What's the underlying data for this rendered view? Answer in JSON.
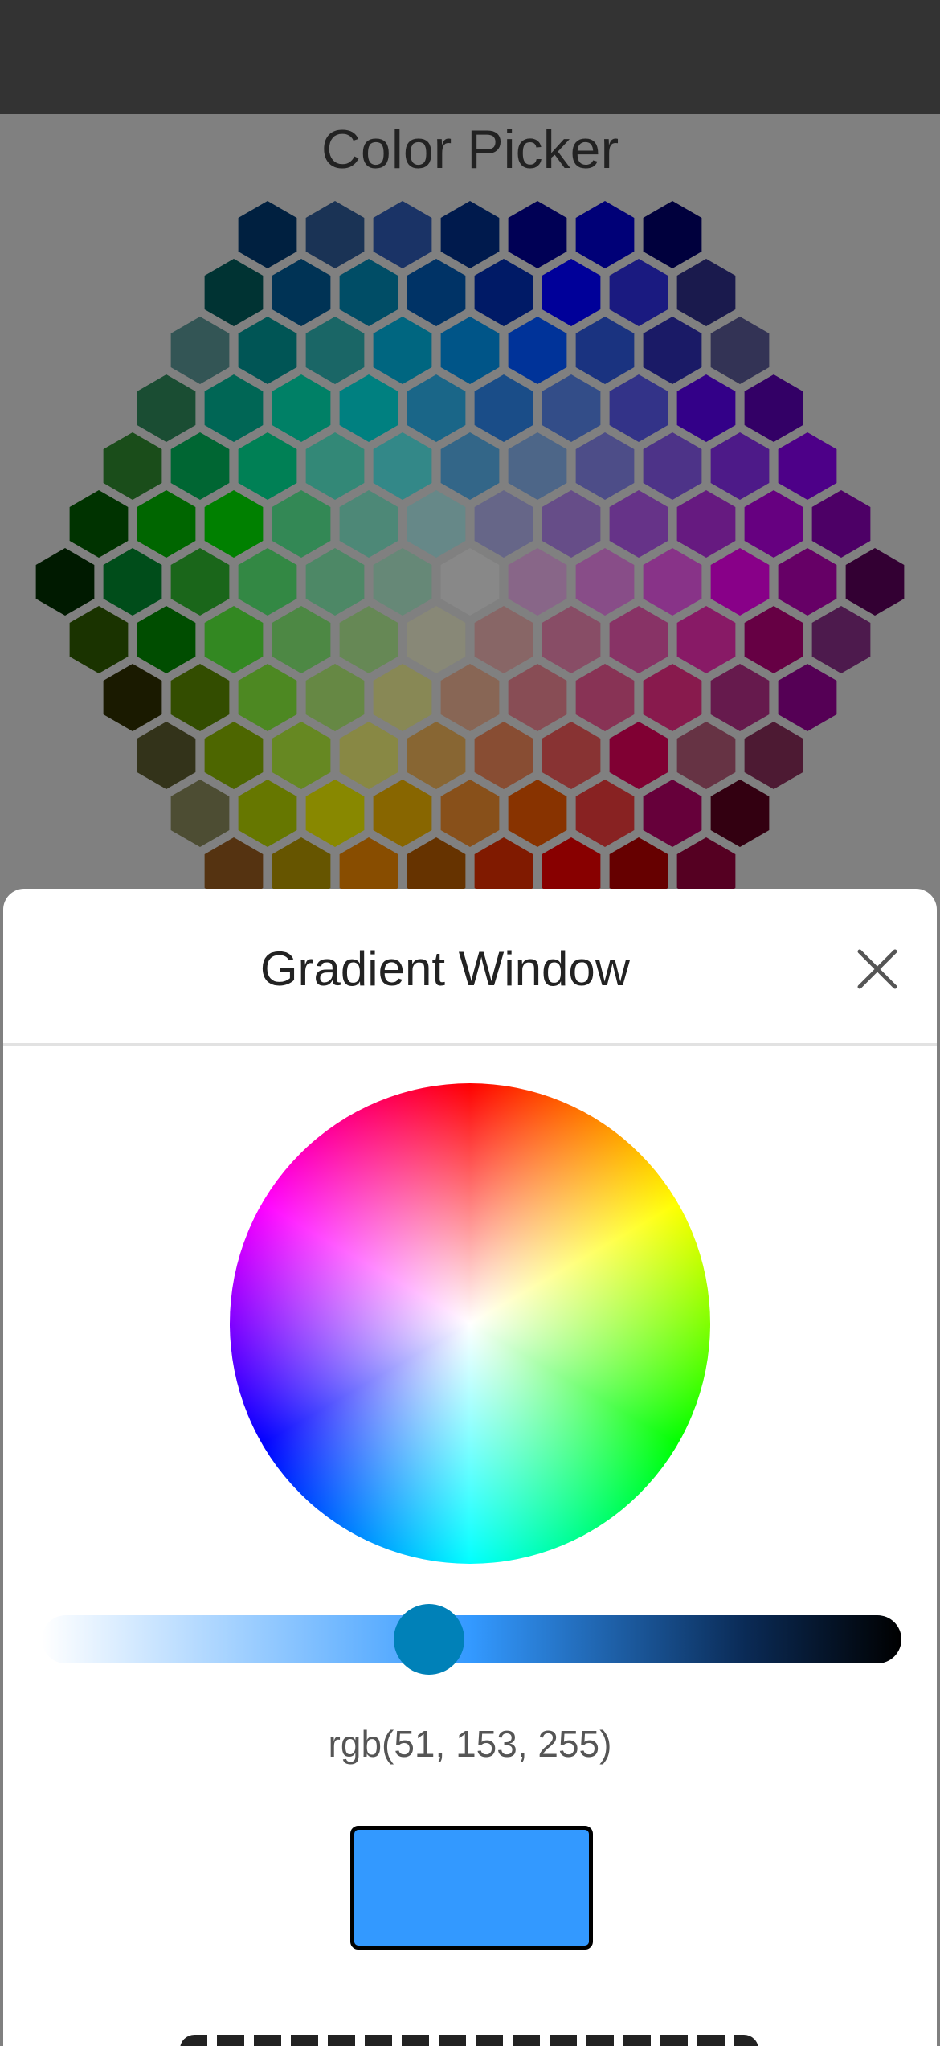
{
  "app": {
    "title": "Color Picker"
  },
  "sheet": {
    "title": "Gradient Window",
    "close_icon": "close-icon"
  },
  "gradient": {
    "rgb_text": "rgb(51, 153, 255)",
    "selected_color": "#3399ff",
    "brightness_level": 0.45
  },
  "hex_rows": [
    [
      "#002040",
      "#1a3355",
      "#1a3366",
      "#001a4d",
      "#000055",
      "#000077",
      "#00003d"
    ],
    [
      "#003333",
      "#003355",
      "#004d66",
      "#003366",
      "#001a66",
      "#000099",
      "#1a1a80",
      "#1a1a4d"
    ],
    [
      "#335555",
      "#005555",
      "#1a6666",
      "#006680",
      "#005588",
      "#003399",
      "#1a3380",
      "#1a1a66",
      "#333355"
    ],
    [
      "#1a4d33",
      "#006655",
      "#008066",
      "#008080",
      "#1a6688",
      "#1a4d88",
      "#334d88",
      "#333388",
      "#330088",
      "#330066"
    ],
    [
      "#1a4d1a",
      "#006633",
      "#008055",
      "#338877",
      "#338888",
      "#336688",
      "#4d6688",
      "#4d4d88",
      "#4d3388",
      "#4d1a88",
      "#4d0088"
    ],
    [
      "#003300",
      "#006600",
      "#008000",
      "#338855",
      "#4d8877",
      "#668888",
      "#666688",
      "#664d88",
      "#663388",
      "#661a80",
      "#660080",
      "#4d0066"
    ],
    [
      "#001a00",
      "#004d1a",
      "#1a661a",
      "#338844",
      "#4d8866",
      "#668877",
      "#888888",
      "#886688",
      "#884d88",
      "#883388",
      "#880088",
      "#660066",
      "#330033"
    ],
    [
      "#1a3300",
      "#004d00",
      "#338822",
      "#4d8844",
      "#668855",
      "#888877",
      "#886666",
      "#884d66",
      "#883366",
      "#881a66",
      "#660044",
      "#4d1a4d"
    ],
    [
      "#1a1a00",
      "#334d00",
      "#4d8822",
      "#668844",
      "#888855",
      "#886655",
      "#884d55",
      "#883355",
      "#881a4d",
      "#661a4d",
      "#550055"
    ],
    [
      "#33331a",
      "#4d6600",
      "#668822",
      "#888844",
      "#886633",
      "#884d33",
      "#883333",
      "#800033",
      "#663344",
      "#4d1a33"
    ],
    [
      "#4d4d33",
      "#667700",
      "#888800",
      "#886600",
      "#88501a",
      "#883300",
      "#882222",
      "#66003a",
      "#330011"
    ],
    [
      "#553311",
      "#665500",
      "#884d00",
      "#663300",
      "#801a00",
      "#880000",
      "#660000",
      "#550022"
    ]
  ]
}
